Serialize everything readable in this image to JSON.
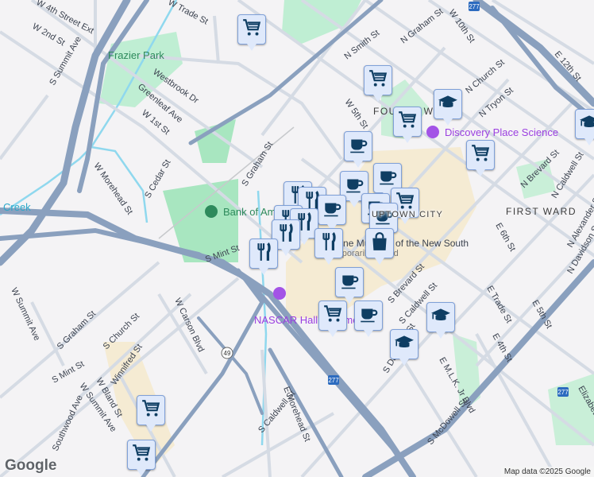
{
  "map": {
    "streets": [
      "W Trade St",
      "W 4th Street Ext",
      "W 2nd St",
      "S Summit Ave",
      "Westbrook Dr",
      "Greenleaf Ave",
      "W 1st St",
      "W Morehead St",
      "S Cedar St",
      "S Graham St",
      "N Smith St",
      "N Graham St",
      "W 10th St",
      "N Church St",
      "N Tryon St",
      "E 12th St",
      "W 5th St",
      "N Brevard St",
      "N Caldwell St",
      "E 6th St",
      "N Alexander St",
      "S Mint St",
      "S Brevard St",
      "N Davidson St",
      "E Trade St",
      "E 5th St",
      "E 4th St",
      "S Caldwell St",
      "S Davidson St",
      "E M.L.K. Jr Blvd",
      "S McDowell St",
      "E Morehead St",
      "W Carson Blvd",
      "S Church St",
      "Winnifred St",
      "W Summit Ave",
      "Southwood Ave",
      "S Graham St",
      "S Mint St",
      "W Bland St",
      "Elizabeth Ave"
    ],
    "parks": [
      "Frazier Park",
      "Creek"
    ],
    "pois": [
      "Discovery Place Science",
      "Bank of America Stadium",
      "NASCAR Hall of Fame",
      "Levine Museum of the New South",
      "Temporarily closed"
    ],
    "neighborhoods": [
      "FOURTH WARD",
      "FIRST WARD",
      "UPTOWN CITY"
    ],
    "highway_shields": [
      "277",
      "277",
      "277",
      "49"
    ],
    "colors": {
      "highway": "#8aa0be",
      "road": "#d5dbe4",
      "park": "#a8e6c0",
      "water": "#8fd8ee",
      "downtown": "#f5ebd3",
      "marker_bg": "#dfe9fb",
      "marker_icon": "#0f3e63"
    }
  },
  "markers": [
    {
      "icon": "shopping-cart"
    },
    {
      "icon": "shopping-cart"
    },
    {
      "icon": "graduation-cap"
    },
    {
      "icon": "shopping-cart"
    },
    {
      "icon": "coffee-cup"
    },
    {
      "icon": "shopping-cart"
    },
    {
      "icon": "graduation-cap"
    },
    {
      "icon": "coffee-cup"
    },
    {
      "icon": "coffee-cup"
    },
    {
      "icon": "fork-knife"
    },
    {
      "icon": "fork-knife"
    },
    {
      "icon": "coffee-cup"
    },
    {
      "icon": "shopping-cart"
    },
    {
      "icon": "coffee-cup"
    },
    {
      "icon": "coffee-cup"
    },
    {
      "icon": "fork-knife"
    },
    {
      "icon": "fork-knife"
    },
    {
      "icon": "fork-knife"
    },
    {
      "icon": "shopping-bag"
    },
    {
      "icon": "fork-knife"
    },
    {
      "icon": "fork-knife"
    },
    {
      "icon": "coffee-cup"
    },
    {
      "icon": "shopping-cart"
    },
    {
      "icon": "coffee-cup"
    },
    {
      "icon": "graduation-cap"
    },
    {
      "icon": "graduation-cap"
    },
    {
      "icon": "shopping-cart"
    },
    {
      "icon": "shopping-cart"
    }
  ],
  "footer": {
    "logo": "Google",
    "attribution": "Map data ©2025 Google"
  }
}
